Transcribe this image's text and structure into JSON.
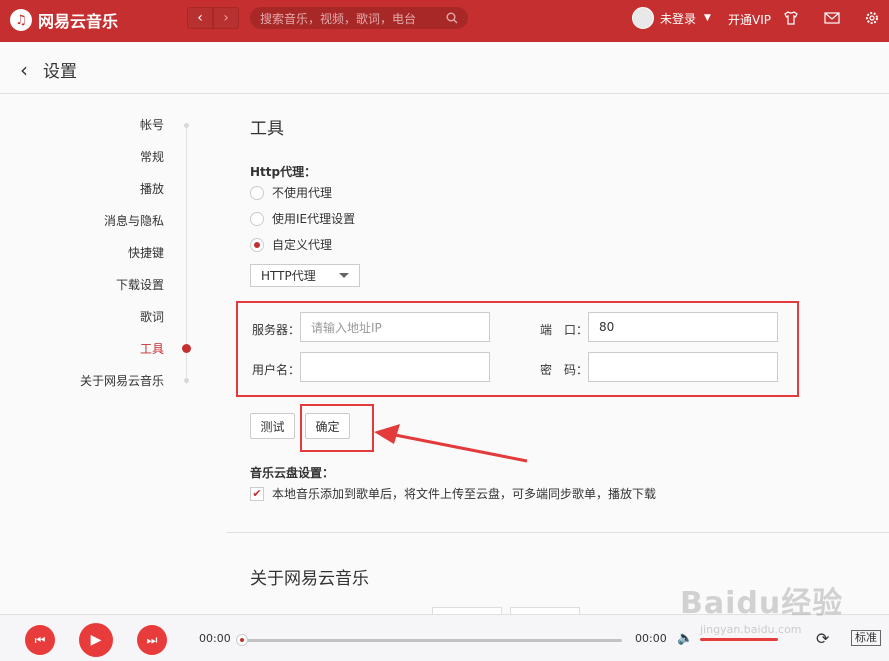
{
  "app": {
    "brand": "网易云音乐"
  },
  "topbar": {
    "search_placeholder": "搜索音乐，视频，歌词，电台",
    "user_name": "未登录",
    "vip_label": "开通VIP"
  },
  "header": {
    "title": "设置"
  },
  "sidebar": {
    "items": [
      {
        "label": "帐号"
      },
      {
        "label": "常规"
      },
      {
        "label": "播放"
      },
      {
        "label": "消息与隐私"
      },
      {
        "label": "快捷键"
      },
      {
        "label": "下载设置"
      },
      {
        "label": "歌词"
      },
      {
        "label": "工具"
      },
      {
        "label": "关于网易云音乐"
      }
    ],
    "active_index": 7
  },
  "tools": {
    "title": "工具",
    "http_proxy_label": "Http代理：",
    "options": [
      {
        "label": "不使用代理",
        "checked": false
      },
      {
        "label": "使用IE代理设置",
        "checked": false
      },
      {
        "label": "自定义代理",
        "checked": true
      }
    ],
    "proxy_type": "HTTP代理",
    "server_label": "服务器：",
    "server_placeholder": "请输入地址IP",
    "port_label": "端　口：",
    "port_value": "80",
    "username_label": "用户名：",
    "password_label": "密　码：",
    "test_button": "测试",
    "confirm_button": "确定",
    "cloud_label": "音乐云盘设置：",
    "cloud_option": "本地音乐添加到歌单后，将文件上传至云盘，可多端同步歌单，播放下载",
    "cloud_checked": true
  },
  "about": {
    "title": "关于网易云音乐"
  },
  "player": {
    "current_time": "00:00",
    "total_time": "00:00",
    "quality": "标准",
    "progress": 0
  },
  "watermark": {
    "text": "Baidu经验",
    "sub": "jingyan.baidu.com"
  },
  "colors": {
    "brand": "#c62f2f",
    "highlight": "#e33b3b"
  }
}
